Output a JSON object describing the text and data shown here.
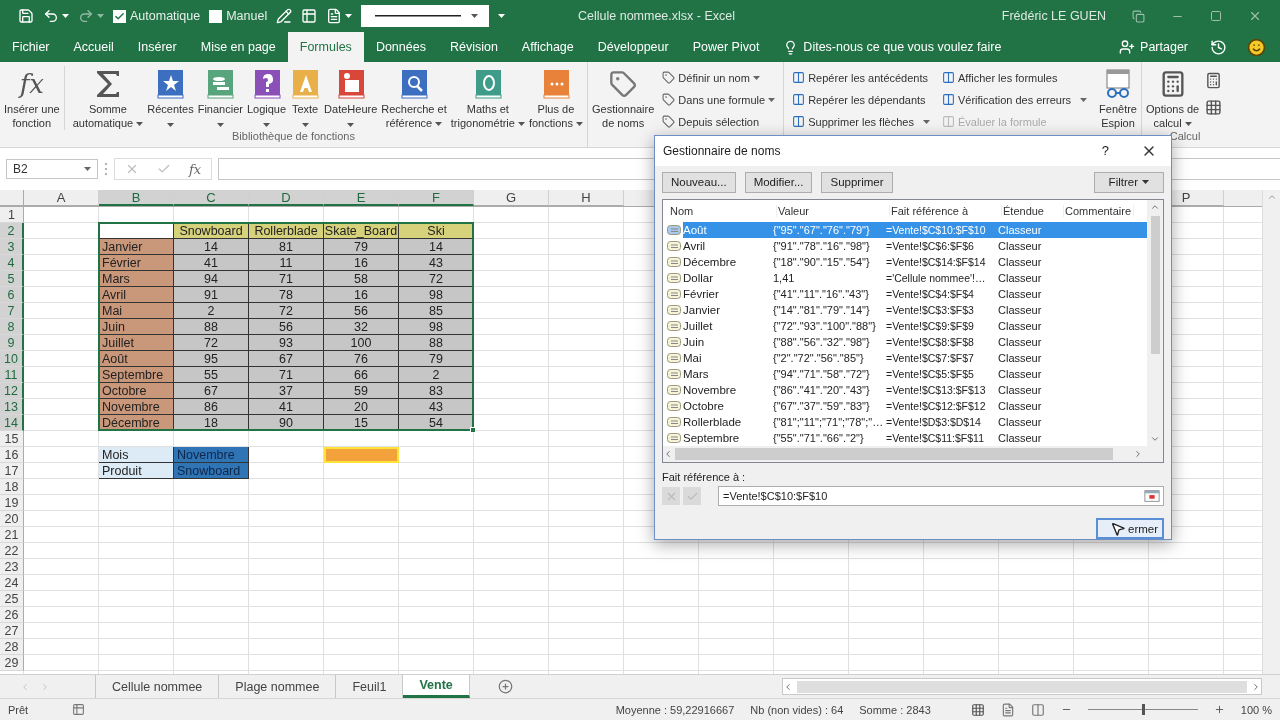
{
  "title_bar": {
    "quick_access": [
      {
        "label": "Automatique",
        "checked": true
      },
      {
        "label": "Manuel",
        "checked": false
      }
    ],
    "document_title": "Cellule nommee.xlsx  -  Excel",
    "user": "Frédéric LE GUEN"
  },
  "menu_tabs": [
    {
      "label": "Fichier",
      "selected": false
    },
    {
      "label": "Accueil",
      "selected": false
    },
    {
      "label": "Insérer",
      "selected": false
    },
    {
      "label": "Mise en page",
      "selected": false
    },
    {
      "label": "Formules",
      "selected": true
    },
    {
      "label": "Données",
      "selected": false
    },
    {
      "label": "Révision",
      "selected": false
    },
    {
      "label": "Affichage",
      "selected": false
    },
    {
      "label": "Développeur",
      "selected": false
    },
    {
      "label": "Power Pivot",
      "selected": false
    }
  ],
  "tell_me": "Dites-nous ce que vous voulez faire",
  "share": "Partager",
  "ribbon": {
    "function_library": {
      "label": "Bibliothèque de fonctions",
      "fx_symbol": "fx",
      "buttons": [
        {
          "lines": [
            "Insérer une",
            "fonction"
          ],
          "dropdown": false
        },
        {
          "lines": [
            "Somme",
            "automatique"
          ],
          "dropdown": true
        },
        {
          "lines": [
            "Récentes"
          ],
          "dropdown": true
        },
        {
          "lines": [
            "Financier"
          ],
          "dropdown": true
        },
        {
          "lines": [
            "Logique"
          ],
          "dropdown": true
        },
        {
          "lines": [
            "Texte"
          ],
          "dropdown": true
        },
        {
          "lines": [
            "DateHeure"
          ],
          "dropdown": true
        },
        {
          "lines": [
            "Recherche et",
            "référence"
          ],
          "dropdown": true
        },
        {
          "lines": [
            "Maths et",
            "trigonométrie"
          ],
          "dropdown": true
        },
        {
          "lines": [
            "Plus de",
            "fonctions"
          ],
          "dropdown": true
        }
      ]
    },
    "names": {
      "manager": [
        "Gestionnaire",
        "de noms"
      ],
      "items": [
        {
          "label": "Définir un nom",
          "dropdown": true
        },
        {
          "label": "Dans une formule",
          "dropdown": true
        },
        {
          "label": "Depuis sélection",
          "dropdown": false
        }
      ]
    },
    "auditing": {
      "columns": [
        [
          {
            "label": "Repérer les antécédents",
            "dropdown": false,
            "disabled": false
          },
          {
            "label": "Repérer les dépendants",
            "dropdown": false,
            "disabled": false
          },
          {
            "label": "Supprimer les flèches",
            "dropdown": true,
            "disabled": false
          }
        ],
        [
          {
            "label": "Afficher les formules",
            "dropdown": false,
            "disabled": false
          },
          {
            "label": "Vérification des erreurs",
            "dropdown": true,
            "disabled": false
          },
          {
            "label": "Évaluer la formule",
            "dropdown": false,
            "disabled": true
          }
        ]
      ]
    },
    "watch": [
      "Fenêtre",
      "Espion"
    ],
    "calculation": {
      "label": "Calcul",
      "options": [
        "Options de",
        "calcul"
      ]
    }
  },
  "formula_bar": {
    "name_box": "B2",
    "fx_symbol": "fx"
  },
  "sheet": {
    "column_headers": [
      {
        "label": "A",
        "selected": false
      },
      {
        "label": "B",
        "selected": true
      },
      {
        "label": "C",
        "selected": true
      },
      {
        "label": "D",
        "selected": true
      },
      {
        "label": "E",
        "selected": true
      },
      {
        "label": "F",
        "selected": true
      },
      {
        "label": "G",
        "selected": false
      },
      {
        "label": "H",
        "selected": false
      }
    ],
    "column_headers_right": [
      "P"
    ],
    "row_headers": [
      {
        "label": "1",
        "selected": false
      },
      {
        "label": "2",
        "selected": true
      },
      {
        "label": "3",
        "selected": true
      },
      {
        "label": "4",
        "selected": true
      },
      {
        "label": "5",
        "selected": true
      },
      {
        "label": "6",
        "selected": true
      },
      {
        "label": "7",
        "selected": true
      },
      {
        "label": "8",
        "selected": true
      },
      {
        "label": "9",
        "selected": true
      },
      {
        "label": "10",
        "selected": true
      },
      {
        "label": "11",
        "selected": true
      },
      {
        "label": "12",
        "selected": true
      },
      {
        "label": "13",
        "selected": true
      },
      {
        "label": "14",
        "selected": true
      },
      {
        "label": "15",
        "selected": false
      },
      {
        "label": "16",
        "selected": false
      },
      {
        "label": "17",
        "selected": false
      },
      {
        "label": "18",
        "selected": false
      },
      {
        "label": "19",
        "selected": false
      },
      {
        "label": "20",
        "selected": false
      },
      {
        "label": "21",
        "selected": false
      },
      {
        "label": "22",
        "selected": false
      },
      {
        "label": "23",
        "selected": false
      },
      {
        "label": "24",
        "selected": false
      },
      {
        "label": "25",
        "selected": false
      },
      {
        "label": "26",
        "selected": false
      },
      {
        "label": "27",
        "selected": false
      },
      {
        "label": "28",
        "selected": false
      },
      {
        "label": "29",
        "selected": false
      }
    ],
    "table": {
      "header": [
        "Snowboard",
        "Rollerblade",
        "Skate_Board",
        "Ski"
      ],
      "rows": [
        {
          "month": "Janvier",
          "values": [
            "14",
            "81",
            "79",
            "14"
          ]
        },
        {
          "month": "Février",
          "values": [
            "41",
            "11",
            "16",
            "43"
          ]
        },
        {
          "month": "Mars",
          "values": [
            "94",
            "71",
            "58",
            "72"
          ]
        },
        {
          "month": "Avril",
          "values": [
            "91",
            "78",
            "16",
            "98"
          ]
        },
        {
          "month": "Mai",
          "values": [
            "2",
            "72",
            "56",
            "85"
          ]
        },
        {
          "month": "Juin",
          "values": [
            "88",
            "56",
            "32",
            "98"
          ]
        },
        {
          "month": "Juillet",
          "values": [
            "72",
            "93",
            "100",
            "88"
          ]
        },
        {
          "month": "Août",
          "values": [
            "95",
            "67",
            "76",
            "79"
          ]
        },
        {
          "month": "Septembre",
          "values": [
            "55",
            "71",
            "66",
            "2"
          ]
        },
        {
          "month": "Octobre",
          "values": [
            "67",
            "37",
            "59",
            "83"
          ]
        },
        {
          "month": "Novembre",
          "values": [
            "86",
            "41",
            "20",
            "43"
          ]
        },
        {
          "month": "Décembre",
          "values": [
            "18",
            "90",
            "15",
            "54"
          ]
        }
      ]
    },
    "lookup": [
      {
        "label": "Mois",
        "value": "Novembre"
      },
      {
        "label": "Produit",
        "value": "Snowboard"
      }
    ]
  },
  "sheet_tabs": [
    {
      "label": "Cellule nommee",
      "selected": false
    },
    {
      "label": "Plage nommee",
      "selected": false
    },
    {
      "label": "Feuil1",
      "selected": false
    },
    {
      "label": "Vente",
      "selected": true
    }
  ],
  "status_bar": {
    "mode": "Prêt",
    "average": "Moyenne : 59,22916667",
    "count": "Nb (non vides) : 64",
    "sum": "Somme : 2843",
    "zoom_slider": {
      "level": 0.5
    },
    "zoom": "100 %"
  },
  "dialog": {
    "title": "Gestionnaire de noms",
    "help": "?",
    "buttons": [
      "Nouveau...",
      "Modifier...",
      "Supprimer"
    ],
    "filter": "Filtrer",
    "columns": [
      "Nom",
      "Valeur",
      "Fait référence à",
      "Étendue",
      "Commentaire"
    ],
    "names": [
      {
        "name": "Août",
        "value": "{\"95\".\"67\".\"76\".\"79\"}",
        "refers_to": "=Vente!$C$10:$F$10",
        "scope": "Classeur",
        "selected": true
      },
      {
        "name": "Avril",
        "value": "{\"91\".\"78\".\"16\".\"98\"}",
        "refers_to": "=Vente!$C$6:$F$6",
        "scope": "Classeur",
        "selected": false
      },
      {
        "name": "Décembre",
        "value": "{\"18\".\"90\".\"15\".\"54\"}",
        "refers_to": "=Vente!$C$14:$F$14",
        "scope": "Classeur",
        "selected": false
      },
      {
        "name": "Dollar",
        "value": "1,41",
        "refers_to": "='Cellule nommee'!…",
        "scope": "Classeur",
        "selected": false
      },
      {
        "name": "Février",
        "value": "{\"41\".\"11\".\"16\".\"43\"}",
        "refers_to": "=Vente!$C$4:$F$4",
        "scope": "Classeur",
        "selected": false
      },
      {
        "name": "Janvier",
        "value": "{\"14\".\"81\".\"79\".\"14\"}",
        "refers_to": "=Vente!$C$3:$F$3",
        "scope": "Classeur",
        "selected": false
      },
      {
        "name": "Juillet",
        "value": "{\"72\".\"93\".\"100\".\"88\"}",
        "refers_to": "=Vente!$C$9:$F$9",
        "scope": "Classeur",
        "selected": false
      },
      {
        "name": "Juin",
        "value": "{\"88\".\"56\".\"32\".\"98\"}",
        "refers_to": "=Vente!$C$8:$F$8",
        "scope": "Classeur",
        "selected": false
      },
      {
        "name": "Mai",
        "value": "{\"2\".\"72\".\"56\".\"85\"}",
        "refers_to": "=Vente!$C$7:$F$7",
        "scope": "Classeur",
        "selected": false
      },
      {
        "name": "Mars",
        "value": "{\"94\".\"71\".\"58\".\"72\"}",
        "refers_to": "=Vente!$C$5:$F$5",
        "scope": "Classeur",
        "selected": false
      },
      {
        "name": "Novembre",
        "value": "{\"86\".\"41\".\"20\".\"43\"}",
        "refers_to": "=Vente!$C$13:$F$13",
        "scope": "Classeur",
        "selected": false
      },
      {
        "name": "Octobre",
        "value": "{\"67\".\"37\".\"59\".\"83\"}",
        "refers_to": "=Vente!$C$12:$F$12",
        "scope": "Classeur",
        "selected": false
      },
      {
        "name": "Rollerblade",
        "value": "{\"81\";\"11\";\"71\";\"78\";\"…",
        "refers_to": "=Vente!$D$3:$D$14",
        "scope": "Classeur",
        "selected": false
      },
      {
        "name": "Septembre",
        "value": "{\"55\".\"71\".\"66\".\"2\"}",
        "refers_to": "=Vente!$C$11:$F$11",
        "scope": "Classeur",
        "selected": false
      }
    ],
    "refers_to_label": "Fait référence à :",
    "refers_to_value": "=Vente!$C$10:$F$10",
    "close": "ermer"
  }
}
